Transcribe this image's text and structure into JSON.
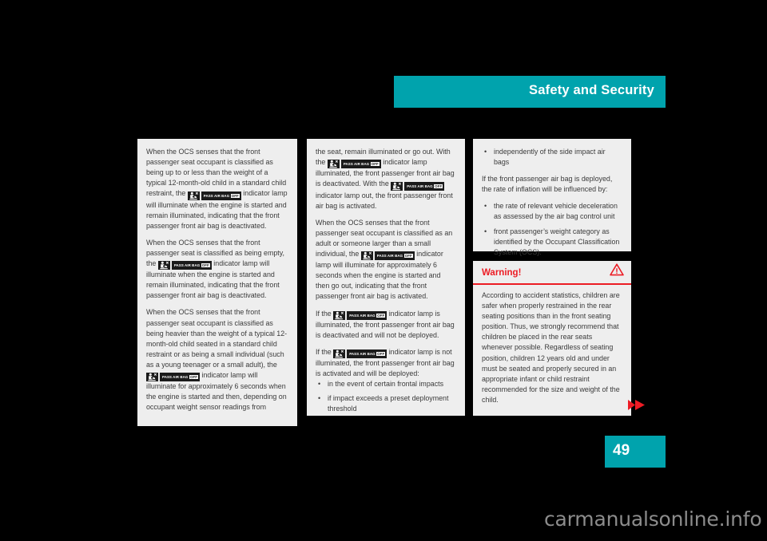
{
  "header": {
    "title": "Safety and Security",
    "bar_color": "#00a3ad"
  },
  "page_number": "49",
  "columns": {
    "left": {
      "paragraphs": [
        {
          "segments": [
            {
              "type": "text",
              "value": "When the OCS senses that the front passenger seat occupant is classified as being up to or less than the weight of a typical 12-month-old child in a standard child restraint, the "
            },
            {
              "type": "lamp",
              "label": "PASS AIR BAG",
              "state": "OFF"
            },
            {
              "type": "text",
              "value": " indicator lamp will illuminate when the engine is started and remain illuminated, indicating that the front passenger front air bag is deactivated."
            }
          ]
        },
        {
          "segments": [
            {
              "type": "text",
              "value": "When the OCS senses that the front passenger seat is classified as being empty, the "
            },
            {
              "type": "lamp",
              "label": "PASS AIR BAG",
              "state": "OFF"
            },
            {
              "type": "text",
              "value": " indicator lamp will illuminate when the engine is started and remain illuminated, indicating that the front passenger front air bag is deactivated."
            }
          ]
        },
        {
          "segments": [
            {
              "type": "text",
              "value": "When the OCS senses that the front passenger seat occupant is classified as being heavier than the weight of a typical 12-month-old child seated in a standard child restraint or as being a small individual (such as a young teenager or a small adult), the "
            },
            {
              "type": "lamp",
              "label": "PASS AIR BAG",
              "state": "OFF"
            },
            {
              "type": "text",
              "value": " indicator lamp will illuminate for approximately 6 seconds when the engine is started and then, depending on occupant weight sensor readings from"
            }
          ]
        }
      ]
    },
    "middle": {
      "paragraphs": [
        {
          "segments": [
            {
              "type": "text",
              "value": "the seat, remain illuminated or go out. With the "
            },
            {
              "type": "lamp",
              "label": "PASS AIR BAG",
              "state": "OFF"
            },
            {
              "type": "text",
              "value": " indicator lamp illuminated, the front passenger front air bag is deactivated. With the "
            },
            {
              "type": "lamp",
              "label": "PASS AIR BAG",
              "state": "OFF"
            },
            {
              "type": "text",
              "value": " indicator lamp out, the front passenger front air bag is activated."
            }
          ]
        },
        {
          "segments": [
            {
              "type": "text",
              "value": "When the OCS senses that the front passenger seat occupant is classified as an adult or someone larger than a small individual, the "
            },
            {
              "type": "lamp",
              "label": "PASS AIR BAG",
              "state": "OFF"
            },
            {
              "type": "text",
              "value": " indicator lamp will illuminate for approximately 6 seconds when the engine is started and then go out, indicating that the front passenger front air bag is activated."
            }
          ]
        },
        {
          "segments": [
            {
              "type": "text",
              "value": "If the "
            },
            {
              "type": "lamp",
              "label": "PASS AIR BAG",
              "state": "OFF"
            },
            {
              "type": "text",
              "value": " indicator lamp is illuminated, the front passenger front air bag is deactivated and will not be deployed."
            }
          ]
        },
        {
          "segments": [
            {
              "type": "text",
              "value": "If the "
            },
            {
              "type": "lamp",
              "label": "PASS AIR BAG",
              "state": "OFF"
            },
            {
              "type": "text",
              "value": " indicator lamp is not illuminated, the front passenger front air bag is activated and will be deployed:"
            }
          ]
        }
      ],
      "bullets": [
        "in the event of certain frontal impacts",
        "if impact exceeds a preset deployment threshold"
      ]
    },
    "right_top": {
      "bullets_first": [
        "independently of the side impact air bags"
      ],
      "intro": "If the front passenger air bag is deployed, the rate of inflation will be influenced by:",
      "bullets_second": [
        "the rate of relevant vehicle deceleration as assessed by the air bag control unit",
        "front passenger’s weight category as identified by the Occupant Classification System (OCS)."
      ]
    }
  },
  "warning": {
    "title": "Warning!",
    "accent_color": "#ec1c24",
    "body": "According to accident statistics, children are safer when properly restrained in the rear seating positions than in the front seating position. Thus, we strongly recommend that children be placed in the rear seats whenever possible. Regardless of seating position, children 12 years old and under must be seated and properly secured in an appropriate infant or child restraint recommended for the size and weight of the child."
  },
  "watermark": "carmanualsonline.info"
}
